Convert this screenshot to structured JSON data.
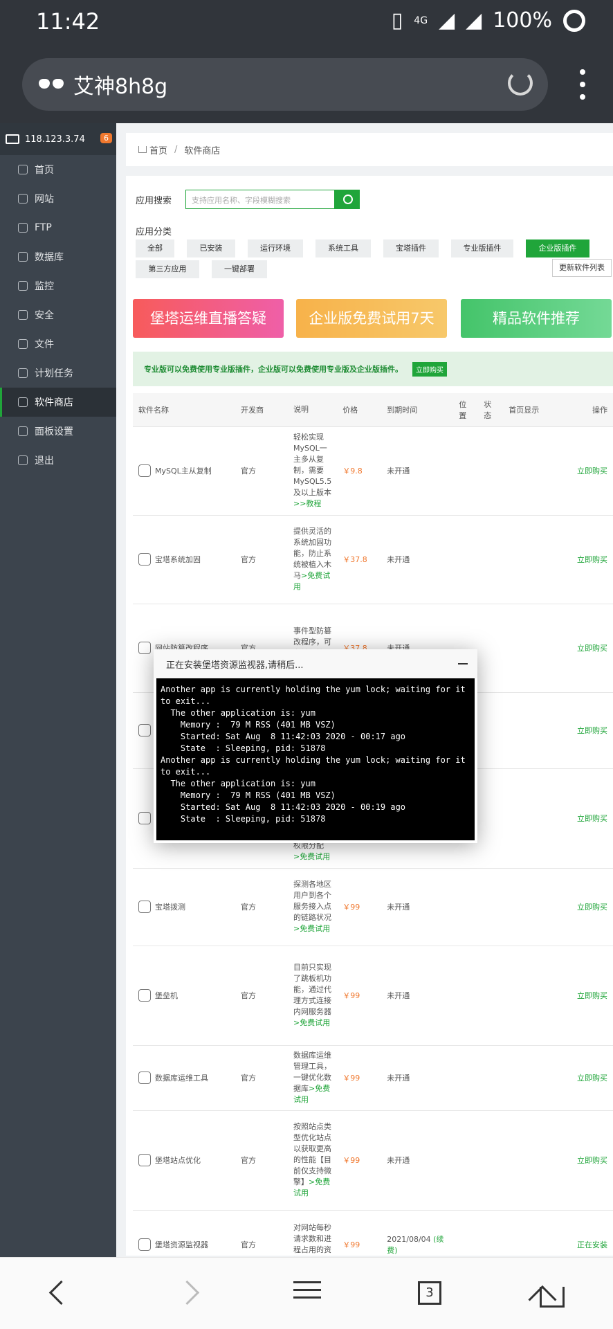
{
  "statusbar": {
    "time": "11:42",
    "battery": "100%",
    "network": "4G"
  },
  "browser": {
    "title": "艾神8h8g",
    "tab_count": "3"
  },
  "sidebar": {
    "ip": "118.123.3.74",
    "badge": "6",
    "items": [
      {
        "label": "首页"
      },
      {
        "label": "网站"
      },
      {
        "label": "FTP"
      },
      {
        "label": "数据库"
      },
      {
        "label": "监控"
      },
      {
        "label": "安全"
      },
      {
        "label": "文件"
      },
      {
        "label": "计划任务"
      },
      {
        "label": "软件商店"
      },
      {
        "label": "面板设置"
      },
      {
        "label": "退出"
      }
    ]
  },
  "breadcrumb": {
    "home": "首页",
    "current": "软件商店"
  },
  "search": {
    "label": "应用搜索",
    "placeholder": "支持应用名称、字段模糊搜索"
  },
  "categories": {
    "label": "应用分类",
    "items": [
      "全部",
      "已安装",
      "运行环境",
      "系统工具",
      "宝塔插件",
      "专业版插件",
      "企业版插件",
      "第三方应用",
      "一键部署"
    ],
    "update_button": "更新软件列表"
  },
  "banners": [
    "堡塔运维直播答疑",
    "企业版免费试用7天",
    "精品软件推荐"
  ],
  "notice": {
    "text": "专业版可以免费使用专业版插件，企业版可以免费使用专业版及企业版插件。",
    "button": "立即购买"
  },
  "table": {
    "headers": [
      "软件名称",
      "开发商",
      "说明",
      "价格",
      "到期时间",
      "位置",
      "状态",
      "首页显示",
      "操作"
    ],
    "rows": [
      {
        "name": "MySQL主从复制",
        "dev": "官方",
        "desc": "轻松实现MySQL一主多从复制，需要MySQL5.5及以上版本",
        "desc_link": ">>教程",
        "price": "￥9.8",
        "expire": "未开通",
        "op": "立即购买"
      },
      {
        "name": "宝塔系统加固",
        "dev": "官方",
        "desc": "提供灵活的系统加固功能，防止系统被植入木马",
        "desc_link": ">免费试用",
        "price": "￥37.8",
        "expire": "未开通",
        "op": "立即购买"
      },
      {
        "name": "网站防篡改程序",
        "dev": "官方",
        "desc": "事件型防篡改程序，可有效保护网站重",
        "desc_link": "",
        "price": "￥37.8",
        "expire": "未开通",
        "op": "立即购买"
      },
      {
        "name": "",
        "dev": "",
        "desc": "",
        "desc_link": "",
        "price": "",
        "expire": "",
        "op": "立即购买"
      },
      {
        "name": "",
        "dev": "",
        "desc": "权限分配",
        "desc_link": ">免费试用",
        "price": "",
        "expire": "",
        "op": "立即购买"
      },
      {
        "name": "宝塔拨测",
        "dev": "官方",
        "desc": "探测各地区用户到各个服务接入点的链路状况",
        "desc_link": ">免费试用",
        "price": "￥99",
        "expire": "未开通",
        "op": "立即购买"
      },
      {
        "name": "堡垒机",
        "dev": "官方",
        "desc": "目前只实现了跳板机功能，通过代理方式连接内网服务器",
        "desc_link": ">免费试用",
        "price": "￥99",
        "expire": "未开通",
        "op": "立即购买"
      },
      {
        "name": "数据库运维工具",
        "dev": "官方",
        "desc": "数据库运维管理工具，一键优化数据库",
        "desc_link": ">免费试用",
        "price": "￥99",
        "expire": "未开通",
        "op": "立即购买"
      },
      {
        "name": "堡塔站点优化",
        "dev": "官方",
        "desc": "按照站点类型优化站点以获取更高的性能【目前仅支持微擎】",
        "desc_link": ">免费试用",
        "price": "￥99",
        "expire": "未开通",
        "op": "立即购买"
      },
      {
        "name": "堡塔资源监视器",
        "dev": "官方",
        "desc": "对网站每秒请求数和进程占用的资源",
        "desc_link": "",
        "price": "￥99",
        "expire": "2021/08/04",
        "expire_link": "(续费)",
        "op": "正在安装"
      }
    ]
  },
  "modal": {
    "title": "正在安装堡塔资源监视器,请稍后...",
    "log": "Another app is currently holding the yum lock; waiting for it to exit...\n  The other application is: yum\n    Memory :  79 M RSS (401 MB VSZ)\n    Started: Sat Aug  8 11:42:03 2020 - 00:17 ago\n    State  : Sleeping, pid: 51878\nAnother app is currently holding the yum lock; waiting for it to exit...\n  The other application is: yum\n    Memory :  79 M RSS (401 MB VSZ)\n    Started: Sat Aug  8 11:42:03 2020 - 00:19 ago\n    State  : Sleeping, pid: 51878"
  },
  "colors": {
    "accent": "#20a53a",
    "sidebar_bg": "#3c444d",
    "price": "#f0782e"
  }
}
